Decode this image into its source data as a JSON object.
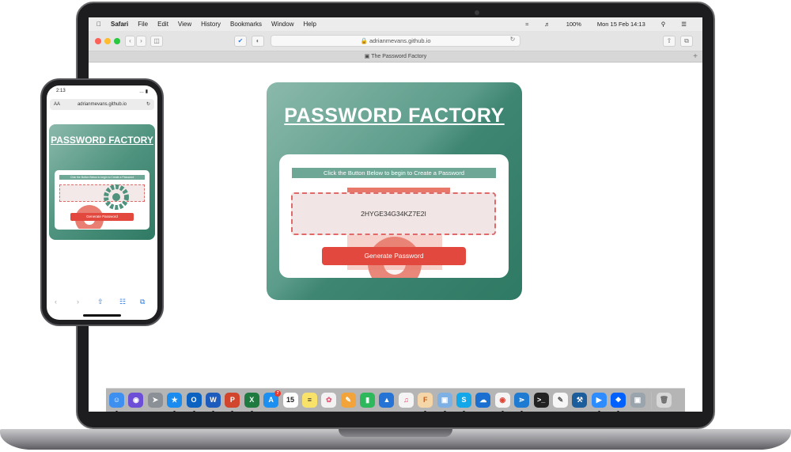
{
  "mac": {
    "menubar": {
      "apple": "",
      "app_name": "Safari",
      "menus": [
        "File",
        "Edit",
        "View",
        "History",
        "Bookmarks",
        "Window",
        "Help"
      ],
      "battery": "100%",
      "clock": "Mon 15 Feb 14:13"
    },
    "safari": {
      "url": "adrianmevans.github.io",
      "tab_title": "The Password Factory"
    },
    "dock_apps": [
      "Finder",
      "Siri",
      "Launchpad",
      "Safari",
      "Outlook",
      "Word",
      "PowerPoint",
      "Excel",
      "App Store",
      "Calendar",
      "Notes",
      "Photos",
      "Pages",
      "Numbers",
      "Keynote",
      "Music",
      "Font",
      "Preview",
      "Skype",
      "OneDrive",
      "Chrome",
      "VS Code",
      "Terminal",
      "TextEdit",
      "Xcode",
      "Zoom",
      "Dropbox",
      "Image Capture",
      "Trash"
    ],
    "calendar_date": "15",
    "app_store_badge": "7"
  },
  "page": {
    "title": "PASSWORD FACTORY",
    "instruction": "Click the Button Below to begin to Create a Password",
    "password": "2HYGE34G34KZ7E2I",
    "generate_button": "Generate Password"
  },
  "iphone": {
    "time": "2:13",
    "url": "adrianmevans.github.io",
    "aa": "AA",
    "title": "PASSWORD FACTORY",
    "instruction": "Click the Button Below to begin to Create a Password",
    "generate_button": "Generate Password"
  },
  "colors": {
    "card_green": "#3e8572",
    "banner_green": "#6ea796",
    "button_red": "#e2483d",
    "output_border": "#e06a6a"
  }
}
